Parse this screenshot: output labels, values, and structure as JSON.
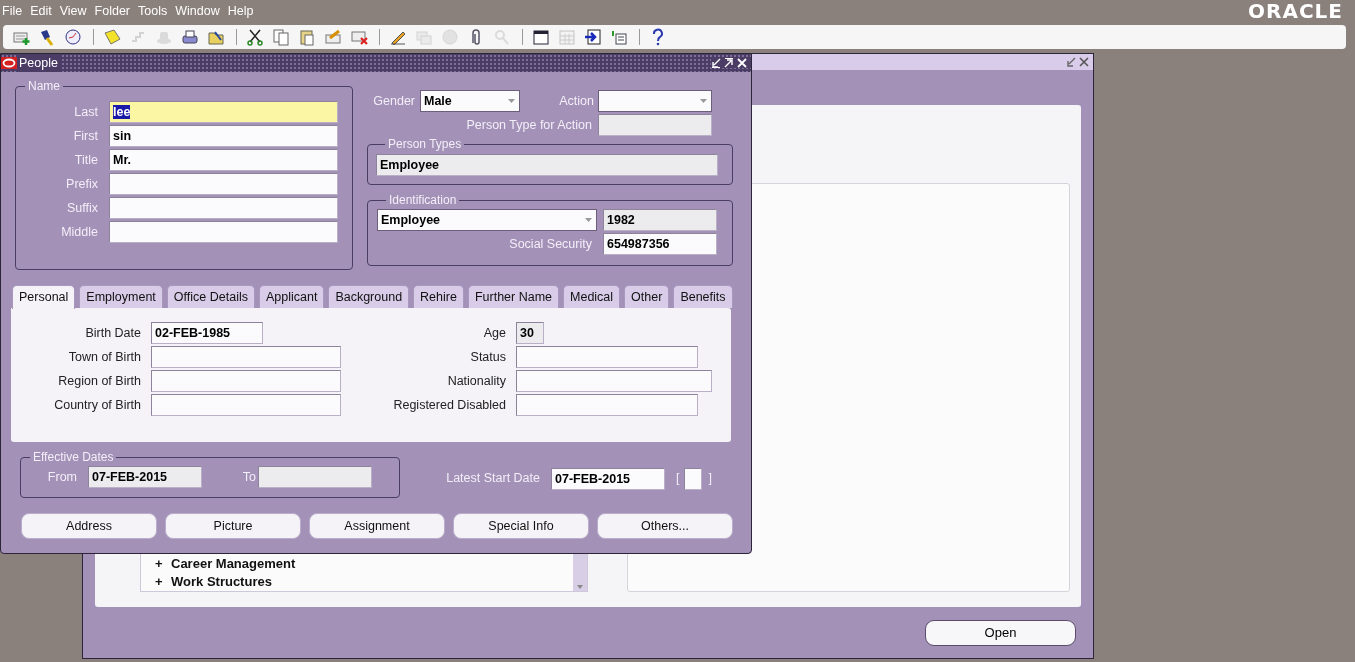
{
  "menu_bar": {
    "items": [
      {
        "label": "File"
      },
      {
        "label": "Edit"
      },
      {
        "label": "View"
      },
      {
        "label": "Folder"
      },
      {
        "label": "Tools"
      },
      {
        "label": "Window"
      },
      {
        "label": "Help"
      }
    ],
    "logo": "ORACLE"
  },
  "toolbar": {
    "groups": [
      [
        {
          "disabled": false
        },
        {
          "disabled": false
        },
        {
          "disabled": false
        }
      ],
      [
        {
          "disabled": false
        },
        {
          "disabled": true
        },
        {
          "disabled": true
        },
        {
          "disabled": false
        },
        {
          "disabled": false
        }
      ],
      [
        {
          "disabled": false
        },
        {
          "disabled": false
        },
        {
          "disabled": false
        },
        {
          "disabled": false
        },
        {
          "disabled": false
        }
      ],
      [
        {
          "disabled": false
        },
        {
          "disabled": true
        },
        {
          "disabled": true
        },
        {
          "disabled": false
        },
        {
          "disabled": true
        }
      ],
      [
        {
          "disabled": false
        },
        {
          "disabled": true
        },
        {
          "disabled": false
        },
        {
          "disabled": false
        }
      ],
      [
        {
          "disabled": false
        }
      ]
    ]
  },
  "navigator_window": {
    "tree_items": [
      {
        "sign": "+",
        "label": "Career Management"
      },
      {
        "sign": "+",
        "label": "Work Structures"
      }
    ],
    "open_button": "Open"
  },
  "people_window": {
    "title": "People",
    "name_group": {
      "legend": "Name",
      "fields": [
        {
          "label": "Last",
          "value": "lee",
          "focused": true
        },
        {
          "label": "First",
          "value": "sin",
          "focused": false
        },
        {
          "label": "Title",
          "value": "Mr.",
          "focused": false
        },
        {
          "label": "Prefix",
          "focused": false
        },
        {
          "label": "Suffix",
          "focused": false
        },
        {
          "label": "Middle",
          "focused": false
        }
      ]
    },
    "gender": {
      "label": "Gender",
      "value": "Male"
    },
    "action": {
      "label": "Action"
    },
    "person_type_for_action": {
      "label": "Person Type for Action",
      "readonly": true
    },
    "person_types": {
      "legend": "Person Types",
      "value": "Employee",
      "readonly": true
    },
    "identification": {
      "legend": "Identification",
      "type": "Employee",
      "number": "1982",
      "number_readonly": true,
      "ssn_label": "Social Security",
      "ssn": "654987356"
    },
    "tabs": [
      {
        "label": "Personal",
        "selected": true
      },
      {
        "label": "Employment",
        "selected": false
      },
      {
        "label": "Office Details",
        "selected": false
      },
      {
        "label": "Applicant",
        "selected": false
      },
      {
        "label": "Background",
        "selected": false
      },
      {
        "label": "Rehire",
        "selected": false
      },
      {
        "label": "Further Name",
        "selected": false
      },
      {
        "label": "Medical",
        "selected": false
      },
      {
        "label": "Other",
        "selected": false
      },
      {
        "label": "Benefits",
        "selected": false
      }
    ],
    "personal_left": [
      {
        "label": "Birth Date",
        "value": "02-FEB-1985",
        "readonly": false
      },
      {
        "label": "Town of Birth",
        "readonly": false
      },
      {
        "label": "Region of Birth",
        "readonly": false
      },
      {
        "label": "Country of Birth",
        "readonly": false
      }
    ],
    "personal_right": [
      {
        "label": "Age",
        "value": "30",
        "readonly": true
      },
      {
        "label": "Status",
        "readonly": false
      },
      {
        "label": "Nationality",
        "readonly": false
      },
      {
        "label": "Registered Disabled",
        "readonly": false
      }
    ],
    "effective_dates": {
      "legend": "Effective Dates",
      "from_label": "From",
      "from": "07-FEB-2015",
      "to_label": "To",
      "readonly": true
    },
    "latest_start": {
      "label": "Latest Start Date",
      "value": "07-FEB-2015",
      "open_bracket": "[",
      "close_bracket": "]"
    },
    "buttons": [
      "Address",
      "Picture",
      "Assignment",
      "Special Info",
      "Others..."
    ]
  }
}
